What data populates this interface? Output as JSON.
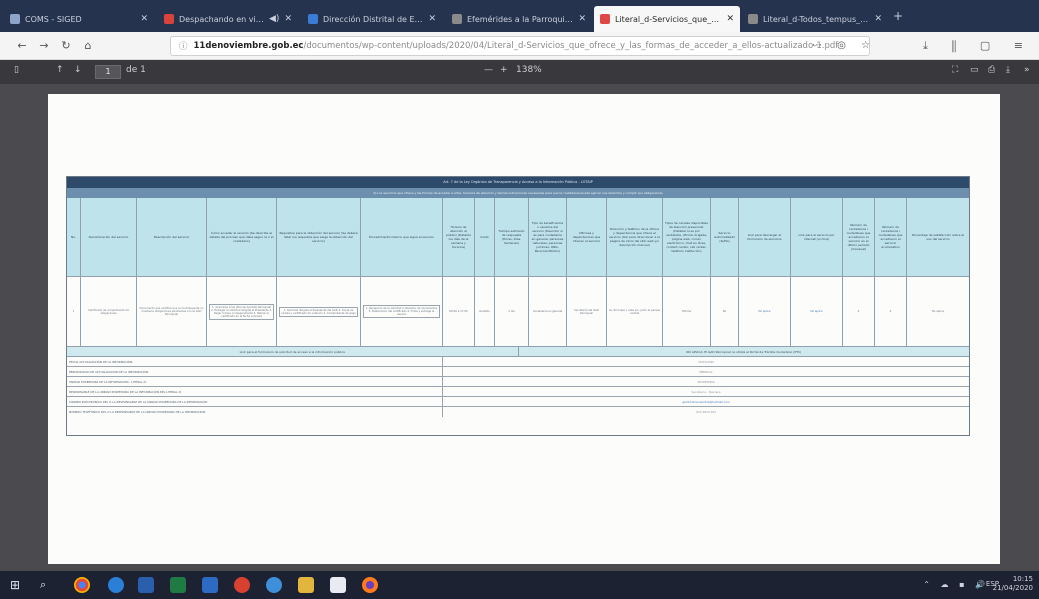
{
  "browser": {
    "tabs": [
      {
        "label": "COMS - SIGED",
        "active": false,
        "color": "#8ea4c8"
      },
      {
        "label": "Despachando en vivo - Jeyo",
        "active": false,
        "color": "#d9433b"
      },
      {
        "label": "Dirección Distrital de Educación",
        "active": false,
        "color": "#3a7bd5"
      },
      {
        "label": "Efemérides a la Parroquia de",
        "active": false,
        "color": "#8a8a8a"
      },
      {
        "label": "Literal_d-Servicios_que_ofrece_y_",
        "active": true,
        "color": "#e04646"
      },
      {
        "label": "Literal_d-Todos_tempus_ec_otorga",
        "active": false,
        "color": "#8a8a8a"
      }
    ],
    "new_tab": "+",
    "url_host": "11denoviembre.gob.ec",
    "url_path": "/documentos/wp-content/uploads/2020/04/Literal_d-Servicios_que_ofrece_y_las_formas_de_acceder_a_ellos-actualizado-1.pdf",
    "zoom": "138%"
  },
  "pdf": {
    "page_number": "1",
    "page_total": "de 1",
    "zoom_out": "—",
    "zoom_in": "+",
    "table": {
      "title": "Art. 7 de la Ley Orgánica de Transparencia y Acceso a la Información Pública - LOTAIP",
      "subtitle": "d) Los servicios que ofrece y las formas de acceder a ellos, horarios de atención y demás indicaciones necesarias para que la ciudadanía pueda ejercer sus derechos y cumplir sus obligaciones",
      "headers": [
        "No.",
        "Denominación del servicio",
        "Descripción del servicio",
        "Cómo acceder al servicio (Se describe el detalle del proceso que debe seguir la o el ciudadano)",
        "Requisitos para la obtención del servicio (Se deberá listar los requisitos que exige la obtención del servicio)",
        "Procedimiento interno que sigue el servicio",
        "Horario de atención al público (Detallar los días de la semana y horarios)",
        "Costo",
        "Tiempo estimado de respuesta (Horas, Días, Semanas)",
        "Tipo de beneficiarios o usuarios del servicio (Describir si es para ciudadanía en general, personas naturales, personas jurídicas, ONG, Personal Médico)",
        "Oficinas y dependencias que ofrecen el servicio",
        "Dirección y teléfono de la oficina y dependencia que ofrece el servicio (link para direccionar a la página de inicio del sitio web y/o descripción manual)",
        "Tipos de canales disponibles de atención presencial: (Detallar si es por ventanilla, oficina, brigada, página web, correo electrónico, chat en línea, contact center, call center, teléfono institución)",
        "Servicio Automatizado (Si/No)",
        "Link para descargar el formulario de servicios",
        "Link para el servicio por internet (on line)",
        "Número de ciudadanos / ciudadanas que accedieron al servicio en el último período (mensual)",
        "Número de ciudadanos / ciudadanas que accedieron al servicio acumulativo",
        "Porcentaje de satisfacción sobre el uso del servicio"
      ],
      "row_values": [
        "1",
        "Certificado de cumplimiento de obligaciones",
        "Documento que certifica que el contribuyente no mantiene obligaciones pendientes con el GAD Parroquial",
        "1. Acercarse a las oficinas del GAD Parroquial 2. Entregar la solicitud dirigida al Presidente 3. Pagar la tasa correspondiente 4. Retirar el certificado en la fecha indicada",
        "1. Solicitud dirigida al Presidente del GAD 2. Copia de cédula y certificado de votación 3. Comprobante de pago",
        "1. Recepción de la solicitud 2. Revisión de documentos 3. Elaboración del certificado 4. Firma y entrega al usuario",
        "08:00 a 17:00",
        "Gratuito",
        "1 día",
        "Ciudadanía en general",
        "Secretaría del GAD Parroquial",
        "Av. Principal y calle s/n, junto al parque central",
        "Oficina",
        "No",
        "No aplica",
        "No aplica",
        "0",
        "0",
        "No aplica"
      ],
      "section_left": "Link para el formulario de solicitud de acceso a la información pública",
      "section_right": "NO APLICA: El GAD Parroquial no utiliza el Portal de Trámite Ciudadano (PTC)",
      "footer_rows": [
        {
          "label": "FECHA ACTUALIZACIÓN DE LA INFORMACIÓN:",
          "value": "31/03/2020"
        },
        {
          "label": "PERIODICIDAD DE ACTUALIZACIÓN DE LA INFORMACIÓN:",
          "value": "MENSUAL"
        },
        {
          "label": "UNIDAD POSEEDORA DE LA INFORMACIÓN - LITERAL d):",
          "value": "SECRETARÍA"
        },
        {
          "label": "RESPONSABLE DE LA UNIDAD POSEEDORA DE LA INFORMACIÓN DEL LITERAL d):",
          "value": "Secretaria - Tesorera"
        },
        {
          "label": "CORREO ELECTRÓNICO DEL O LA RESPONSABLE DE LA UNIDAD POSEEDORA DE LA INFORMACIÓN:",
          "value": "gad11denoviembre@hotmail.com"
        },
        {
          "label": "NÚMERO TELEFÓNICO DEL O LA RESPONSABLE DE LA UNIDAD POSEEDORA DE LA INFORMACIÓN:",
          "value": "(03) 2815 045"
        }
      ]
    }
  },
  "taskbar": {
    "time": "10:15",
    "date": "21/04/2020",
    "lang": "ESP"
  }
}
